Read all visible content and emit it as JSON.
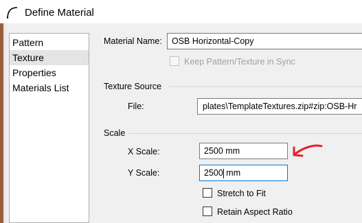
{
  "window": {
    "title": "Define Material",
    "icon": "chief-architect-arc-icon"
  },
  "nav": {
    "items": [
      {
        "label": "Pattern",
        "selected": false
      },
      {
        "label": "Texture",
        "selected": true
      },
      {
        "label": "Properties",
        "selected": false
      },
      {
        "label": "Materials List",
        "selected": false
      }
    ]
  },
  "material": {
    "name_label": "Material Name:",
    "name_value": "OSB Horizontal-Copy",
    "sync_label": "Keep Pattern/Texture in Sync",
    "sync_checked": false
  },
  "texture_source": {
    "heading": "Texture Source",
    "file_label": "File:",
    "file_value": "plates\\TemplateTextures.zip#zip:OSB-Hr"
  },
  "scale": {
    "heading": "Scale",
    "x_label": "X Scale:",
    "x_value": "2500 mm",
    "y_label": "Y Scale:",
    "y_value_before_caret": "2500",
    "y_value_after_caret": " mm",
    "stretch_label": "Stretch to Fit",
    "stretch_checked": false,
    "retain_label": "Retain Aspect Ratio",
    "retain_checked": false
  },
  "colors": {
    "annotation_arrow": "#e8202a",
    "focus_border": "#0078d7"
  }
}
